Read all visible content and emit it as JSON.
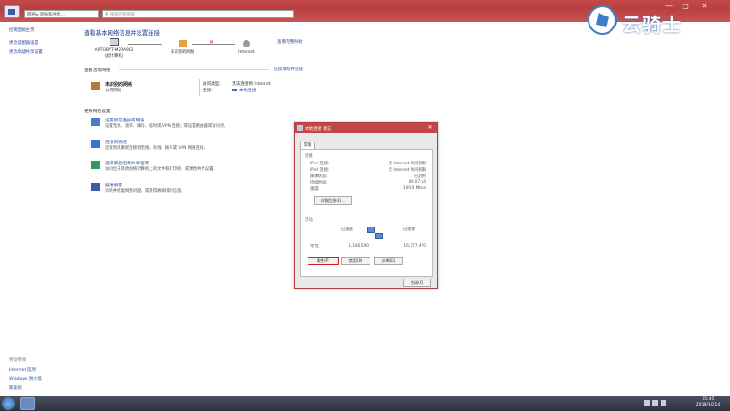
{
  "window": {
    "address": "网络 ▸ 网络和共享...",
    "search_placeholder": "搜索控制面板",
    "min": "—",
    "max": "□",
    "close": "✕"
  },
  "watermark": {
    "text": "云骑士"
  },
  "sidebar": {
    "home": "控制面板主页",
    "adapter_settings": "更改适配器设置",
    "sharing_settings": "更改高级共享设置",
    "see_also": "另请参阅",
    "internet_options": "Internet 选项",
    "firewall": "Windows 防火墙",
    "homegroup": "家庭组"
  },
  "main": {
    "title": "查看基本网络信息并设置连接",
    "view_full_map": "查看完整映射",
    "nodes": {
      "pc_name": "AUTOBVT-M29A9E2",
      "pc_sub": "(此计算机)",
      "unidentified": "未识别的网络",
      "internet": "Internet"
    },
    "active_header": "查看活动网络",
    "connect_disconnect": "连接或断开连接",
    "active": {
      "name": "未识别的网络",
      "type": "公用网络",
      "access_label": "访问类型:",
      "access_value": "无法连接到 Internet",
      "conn_label": "连接:",
      "conn_value": "本地连接"
    },
    "change_header": "更改网络设置",
    "tasks": [
      {
        "title": "设置新的连接或网络",
        "desc": "设置无线、宽带、拨号、临时或 VPN 连接；或设置路由器或访问点。"
      },
      {
        "title": "连接到网络",
        "desc": "连接到或重新连接到无线、有线、拨号或 VPN 网络连接。"
      },
      {
        "title": "选择家庭组和共享选项",
        "desc": "访问位于其他网络计算机上的文件和打印机，或更改共享设置。"
      },
      {
        "title": "疑难解答",
        "desc": "诊断并修复网络问题，或获得故障排除信息。"
      }
    ]
  },
  "dialog": {
    "title": "本地连接 状态",
    "close": "✕",
    "tab": "常规",
    "connection_section": "连接",
    "rows": [
      {
        "label": "IPv4 连接:",
        "value": "无 Internet 访问权限"
      },
      {
        "label": "IPv6 连接:",
        "value": "无 Internet 访问权限"
      },
      {
        "label": "媒体状态:",
        "value": "已启用"
      },
      {
        "label": "持续时间:",
        "value": "00:07:54"
      },
      {
        "label": "速度:",
        "value": "100.0 Mbps"
      }
    ],
    "details_button": "详细信息(E)...",
    "activity_section": "活动",
    "sent_label": "已发送",
    "received_label": "已接收",
    "bytes_label": "字节:",
    "bytes_sent": "1,180,590",
    "bytes_received": "16,777,470",
    "properties_button": "属性(P)",
    "disable_button": "禁用(D)",
    "diagnose_button": "诊断(G)",
    "close_button": "关闭(C)"
  },
  "taskbar": {
    "time": "15:45",
    "date": "2019/10/14"
  }
}
